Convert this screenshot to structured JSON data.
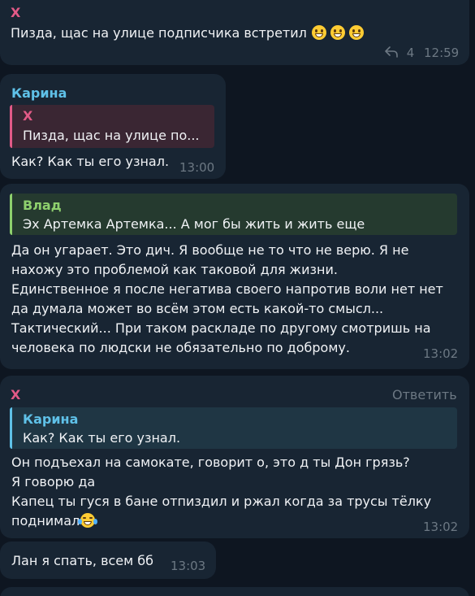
{
  "colors": {
    "background": "#0e1621",
    "bubble": "#182533",
    "name_x": "#e25a87",
    "name_karina": "#5fc1e8",
    "name_vlad": "#8ed06d",
    "timestamp": "#6c7883"
  },
  "messages": [
    {
      "sender": "X",
      "text": "Пизда, щас на улице подписчика встретил",
      "emoji": [
        "grinning-face",
        "grinning-face",
        "grinning-face"
      ],
      "reply_icon": "reply-arrow-icon",
      "reply_count": "4",
      "time": "12:59"
    },
    {
      "sender": "Карина",
      "quote": {
        "name": "X",
        "text": "Пизда, щас на улице по..."
      },
      "text": "Как? Как ты его узнал.",
      "time": "13:00"
    },
    {
      "quote": {
        "name": "Влад",
        "text": "Эх Артемка Артемка... А мог бы жить и жить еще"
      },
      "lines": [
        "Да он угарает. Это дич. Я вообще не то что не верю. Я не",
        "нахожу это проблемой как таковой для жизни.",
        "Единственное я после негатива своего напротив воли нет нет",
        "да думала может во всём этом есть какой-то смысл...",
        "Тактический... При таком раскладе по другому смотришь на",
        "человека по людски не обязательно по доброму."
      ],
      "time": "13:02"
    },
    {
      "sender": "X",
      "reply_label": "Ответить",
      "quote": {
        "name": "Карина",
        "text": "Как? Как ты его узнал."
      },
      "lines": [
        "Он подъехал на самокате, говорит о, это д ты Дон грязь?",
        "Я говорю да",
        "Капец ты гуся в бане отпиздил и ржал когда за трусы тёлку",
        "поднимал"
      ],
      "emoji": [
        "face-with-tears-of-joy"
      ],
      "time": "13:02"
    },
    {
      "text": "Лан я спать, всем бб",
      "time": "13:03"
    }
  ]
}
